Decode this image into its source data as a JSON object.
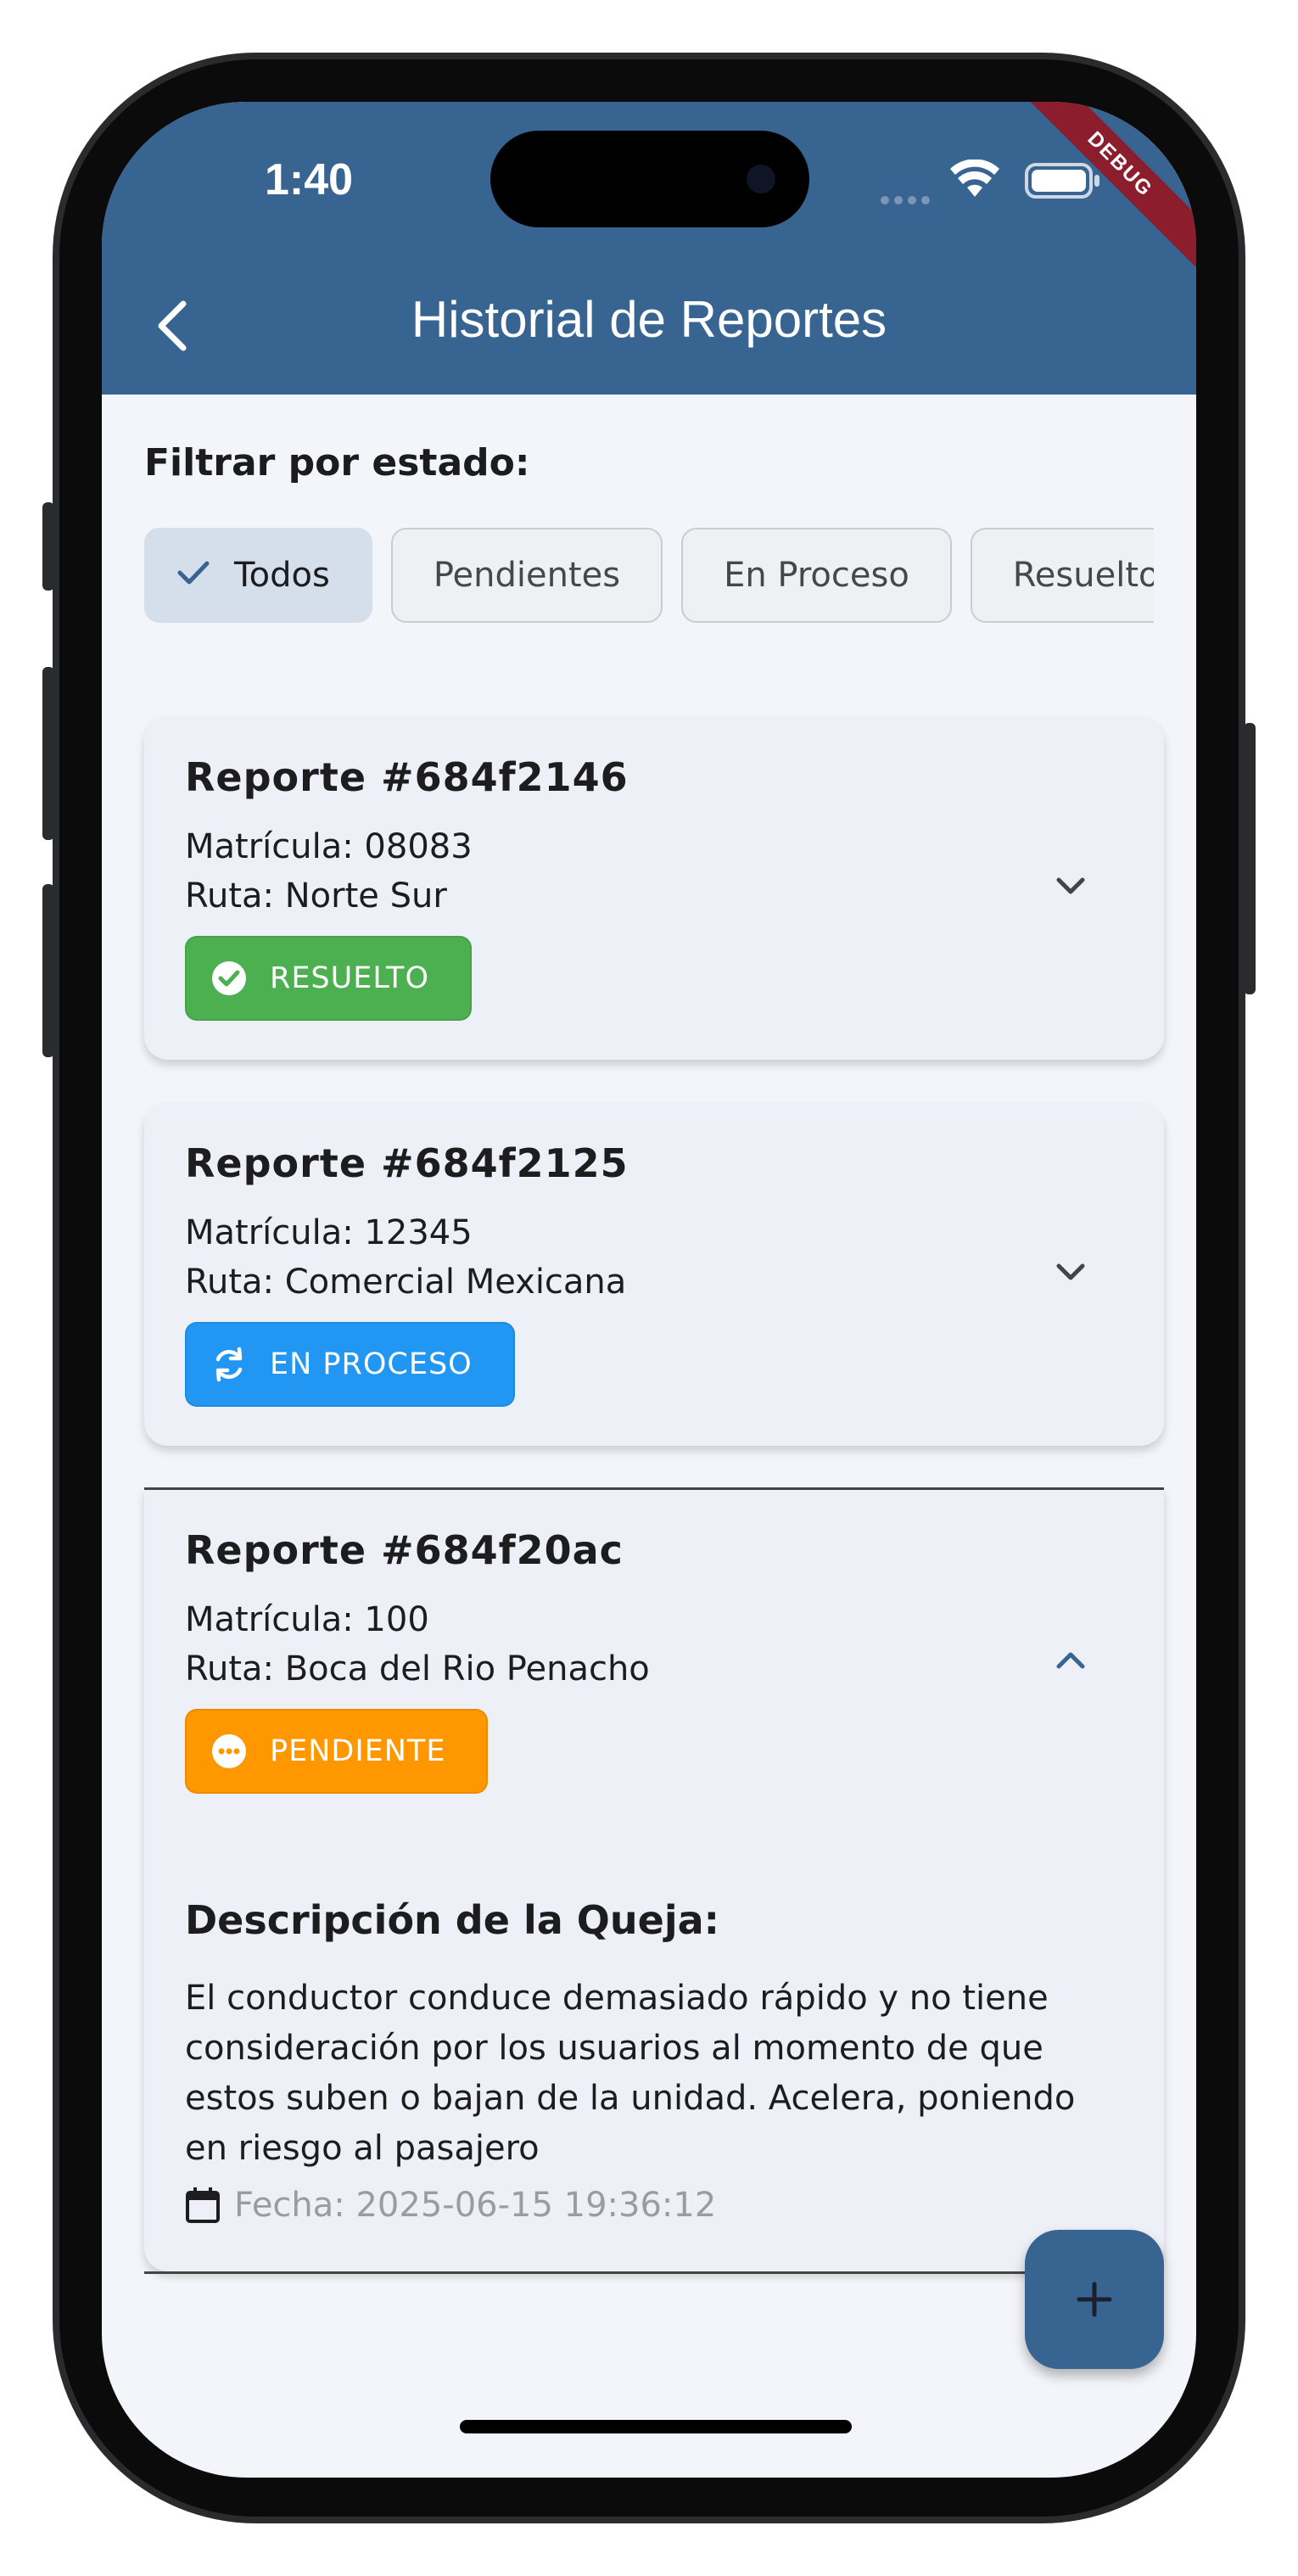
{
  "status_bar": {
    "time": "1:40",
    "debug_label": "DEBUG"
  },
  "app_bar": {
    "title": "Historial de Reportes",
    "back_icon": "chevron-left-icon"
  },
  "filter": {
    "label": "Filtrar por estado:",
    "chips": [
      {
        "label": "Todos",
        "selected": true
      },
      {
        "label": "Pendientes",
        "selected": false
      },
      {
        "label": "En Proceso",
        "selected": false
      },
      {
        "label": "Resuelto",
        "selected": false
      }
    ]
  },
  "reports": [
    {
      "title": "Reporte #684f2146",
      "matricula": "Matrícula: 08083",
      "ruta": "Ruta: Norte Sur",
      "status": "RESUELTO",
      "status_color": "#4caf50",
      "status_icon": "check-circle-icon",
      "expanded": false
    },
    {
      "title": "Reporte #684f2125",
      "matricula": "Matrícula: 12345",
      "ruta": "Ruta: Comercial Mexicana",
      "status": "EN PROCESO",
      "status_color": "#2196f3",
      "status_icon": "sync-icon",
      "expanded": false
    },
    {
      "title": "Reporte #684f20ac",
      "matricula": "Matrícula: 100",
      "ruta": "Ruta: Boca del Rio Penacho",
      "status": "PENDIENTE",
      "status_color": "#ff9800",
      "status_icon": "more-horiz-circle-icon",
      "expanded": true,
      "description_title": "Descripción de la Queja:",
      "description": "El conductor conduce demasiado rápido y no tiene consideración por los usuarios al momento de que estos suben o bajan de la unidad. Acelera, poniendo en riesgo al pasajero",
      "date": "Fecha: 2025-06-15 19:36:12"
    }
  ],
  "fab": {
    "icon": "plus-icon"
  },
  "colors": {
    "primary": "#386492",
    "background": "#f3f5fa",
    "card": "#eef0f7",
    "debug": "#8b1d2c"
  }
}
